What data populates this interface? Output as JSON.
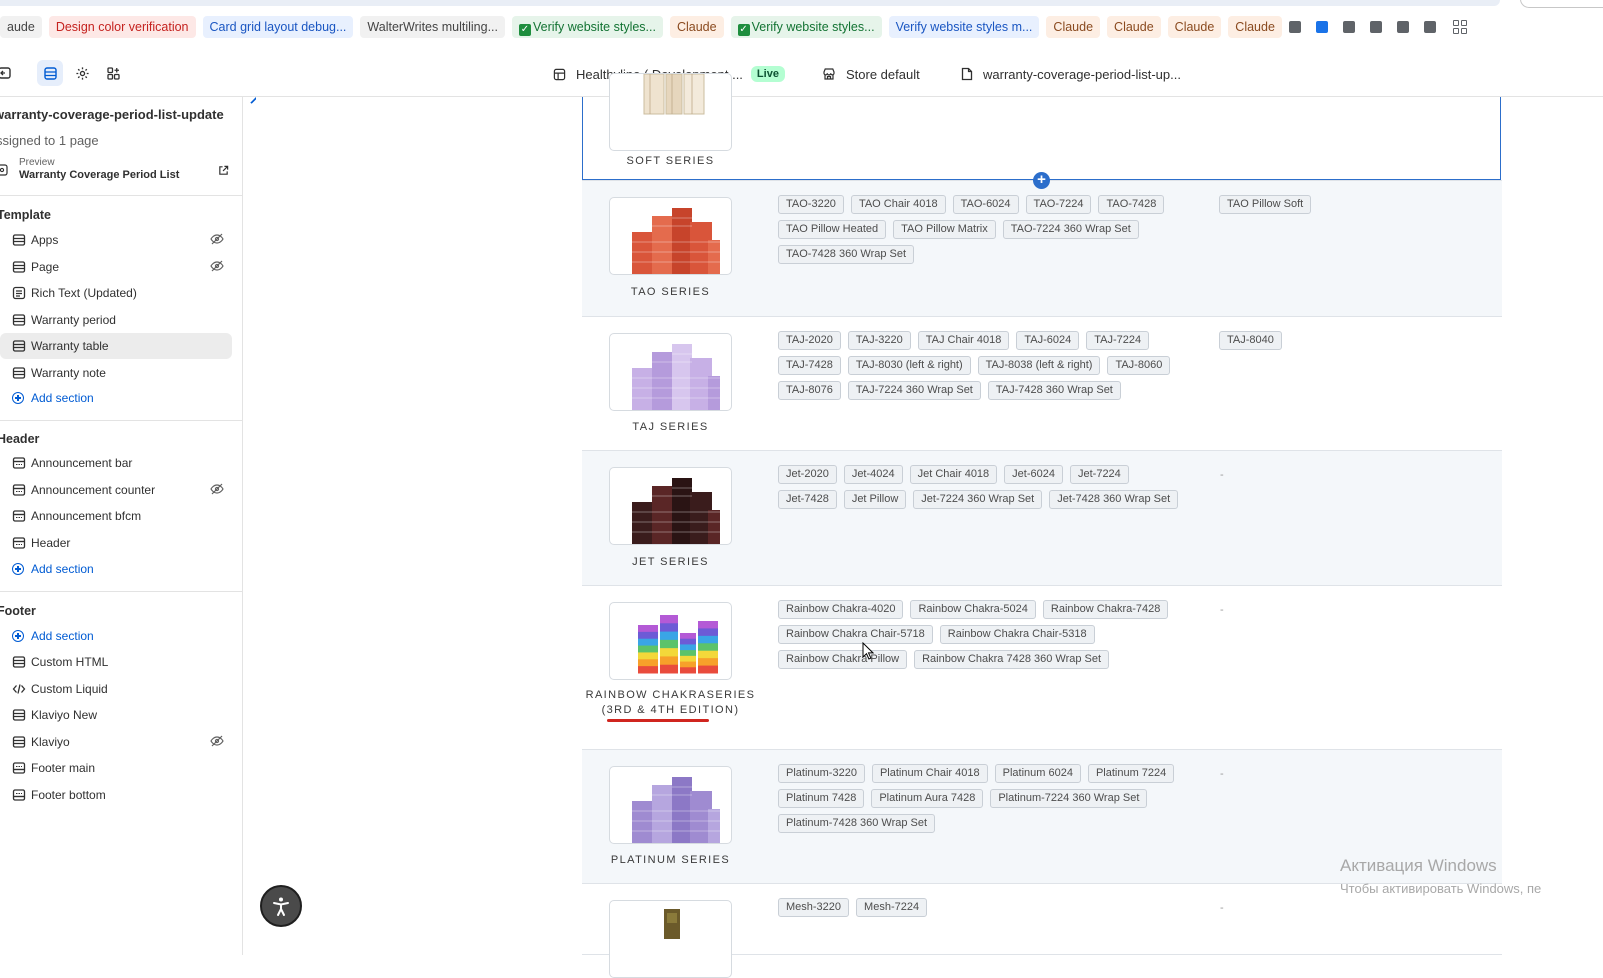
{
  "browser": {
    "chips": [
      {
        "label": "aude",
        "style": "plain",
        "check": false
      },
      {
        "label": "Design color verification",
        "style": "red",
        "check": false
      },
      {
        "label": "Card grid layout debug...",
        "style": "blue",
        "check": false
      },
      {
        "label": "WalterWrites multiling...",
        "style": "plain",
        "check": false
      },
      {
        "label": "Verify website styles...",
        "style": "green",
        "check": true
      },
      {
        "label": "Claude",
        "style": "orange",
        "check": false
      },
      {
        "label": "Verify website styles...",
        "style": "green",
        "check": true
      },
      {
        "label": "Verify website styles m...",
        "style": "blue",
        "check": false
      },
      {
        "label": "Claude",
        "style": "orange",
        "check": false
      },
      {
        "label": "Claude",
        "style": "orange",
        "check": false
      },
      {
        "label": "Claude",
        "style": "orange",
        "check": false
      },
      {
        "label": "Claude",
        "style": "orange",
        "check": false
      }
    ]
  },
  "editor": {
    "store_name": "Healthyline ( Development ...",
    "live_badge": "Live",
    "market": "Store default",
    "template_name": "warranty-coverage-period-list-up..."
  },
  "sidebar": {
    "title": "warranty-coverage-period-list-update",
    "assigned": "ssigned to 1 page",
    "preview_label": "Preview",
    "preview_value": "Warranty Coverage Period List",
    "template_heading": "Template",
    "template_items": [
      {
        "label": "Apps",
        "hidden": true
      },
      {
        "label": "Page",
        "hidden": true
      },
      {
        "label": "Rich Text (Updated)",
        "hidden": false
      },
      {
        "label": "Warranty period",
        "hidden": false
      },
      {
        "label": "Warranty table",
        "hidden": false
      },
      {
        "label": "Warranty note",
        "hidden": false
      }
    ],
    "add_section": "Add section",
    "header_heading": "Header",
    "header_items": [
      {
        "label": "Announcement bar",
        "hidden": false
      },
      {
        "label": "Announcement counter",
        "hidden": true
      },
      {
        "label": "Announcement bfcm",
        "hidden": false
      },
      {
        "label": "Header",
        "hidden": false
      }
    ],
    "footer_heading": "Footer",
    "footer_items": [
      {
        "label": "Custom HTML",
        "hidden": false
      },
      {
        "label": "Custom Liquid",
        "hidden": false
      },
      {
        "label": "Klaviyo New",
        "hidden": false
      },
      {
        "label": "Klaviyo",
        "hidden": true
      },
      {
        "label": "Footer main",
        "hidden": false
      },
      {
        "label": "Footer bottom",
        "hidden": false
      }
    ]
  },
  "table": {
    "rows": [
      {
        "name": "SOFT SERIES",
        "tags": [],
        "extra": [],
        "theme": "soft"
      },
      {
        "name": "TAO SERIES",
        "tags": [
          "TAO-3220",
          "TAO Chair 4018",
          "TAO-6024",
          "TAO-7224",
          "TAO-7428",
          "TAO Pillow Heated",
          "TAO Pillow Matrix",
          "TAO-7224 360 Wrap Set",
          "TAO-7428 360 Wrap Set"
        ],
        "extra": [
          "TAO Pillow Soft"
        ],
        "theme": "tao"
      },
      {
        "name": "TAJ SERIES",
        "tags": [
          "TAJ-2020",
          "TAJ-3220",
          "TAJ Chair 4018",
          "TAJ-6024",
          "TAJ-7224",
          "TAJ-7428",
          "TAJ-8030 (left & right)",
          "TAJ-8038 (left & right)",
          "TAJ-8060",
          "TAJ-8076",
          "TAJ-7224 360 Wrap Set",
          "TAJ-7428 360 Wrap Set"
        ],
        "extra": [
          "TAJ-8040"
        ],
        "theme": "taj"
      },
      {
        "name": "JET SERIES",
        "tags": [
          "Jet-2020",
          "Jet-4024",
          "Jet Chair 4018",
          "Jet-6024",
          "Jet-7224",
          "Jet-7428",
          "Jet Pillow",
          "Jet-7224 360 Wrap Set",
          "Jet-7428 360 Wrap Set"
        ],
        "extra": [],
        "dash": "-",
        "theme": "jet"
      },
      {
        "name": "RAINBOW CHAKRASERIES (3RD & 4TH EDITION)",
        "tags": [
          "Rainbow Chakra-4020",
          "Rainbow Chakra-5024",
          "Rainbow Chakra-7428",
          "Rainbow Chakra Chair-5718",
          "Rainbow Chakra Chair-5318",
          "Rainbow Chakra Pillow",
          "Rainbow Chakra 7428 360 Wrap Set"
        ],
        "extra": [],
        "dash": "-",
        "theme": "rainbow"
      },
      {
        "name": "PLATINUM SERIES",
        "tags": [
          "Platinum-3220",
          "Platinum Chair 4018",
          "Platinum 6024",
          "Platinum 7224",
          "Platinum 7428",
          "Platinum Aura 7428",
          "Platinum-7224 360 Wrap Set",
          "Platinum-7428 360 Wrap Set"
        ],
        "extra": [],
        "dash": "-",
        "theme": "platinum"
      },
      {
        "name": "",
        "tags": [
          "Mesh-3220",
          "Mesh-7224"
        ],
        "extra": [],
        "dash": "-",
        "theme": "mesh"
      }
    ]
  },
  "watermark": {
    "line1": "Активация Windows",
    "line2": "Чтобы активировать Windows, пе"
  },
  "colors": {
    "accent": "#2c6ecb",
    "row_alt": "#f4f7fa"
  }
}
